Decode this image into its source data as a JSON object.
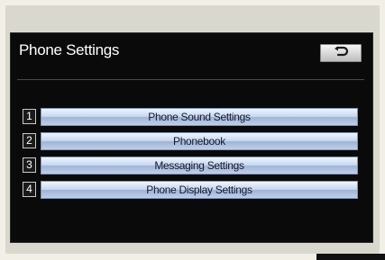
{
  "screen": {
    "title": "Phone Settings",
    "back_icon": "return-arrow-icon"
  },
  "menu": {
    "items": [
      {
        "number": "1",
        "label": "Phone Sound Settings"
      },
      {
        "number": "2",
        "label": "Phonebook"
      },
      {
        "number": "3",
        "label": "Messaging Settings"
      },
      {
        "number": "4",
        "label": "Phone Display Settings"
      }
    ]
  },
  "colors": {
    "screen_background": "#0a0a0a",
    "button_blue": "#c6d7f0",
    "button_border": "#7f95b8",
    "text_white": "#ffffff",
    "text_dark": "#14182a"
  }
}
